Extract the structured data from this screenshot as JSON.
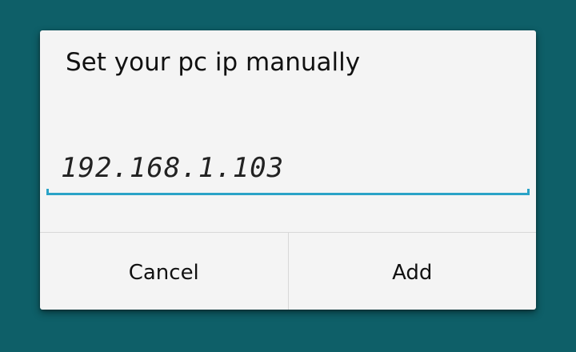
{
  "dialog": {
    "title": "Set your pc ip manually",
    "ip_input": {
      "value": "192.168.1.103"
    },
    "buttons": {
      "cancel_label": "Cancel",
      "add_label": "Add"
    }
  },
  "colors": {
    "background": "#0e5f68",
    "dialog_background": "#f4f4f4",
    "accent": "#2aa3c7",
    "divider": "#d8d8d8"
  }
}
